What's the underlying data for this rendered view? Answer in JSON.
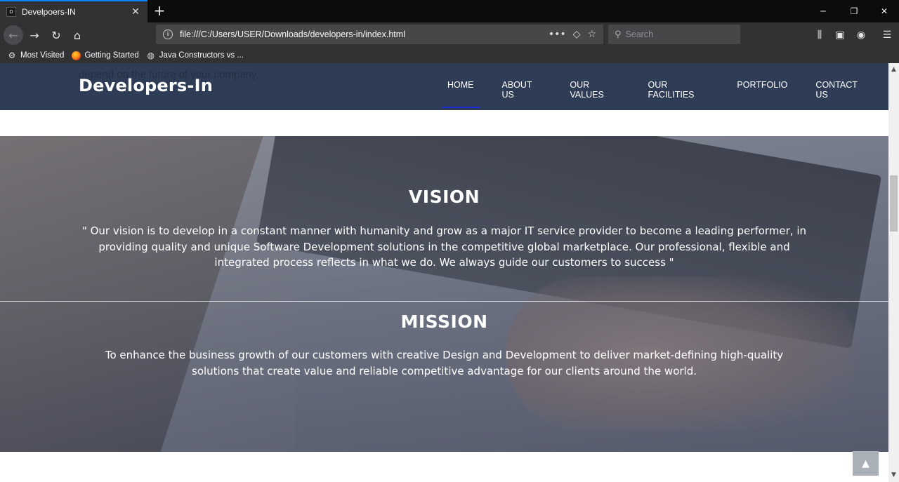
{
  "browser": {
    "tab_title": "Develpoers-IN",
    "favicon_text": "D",
    "url": "file:///C:/Users/USER/Downloads/developers-in/index.html",
    "search_placeholder": "Search",
    "bookmarks": [
      {
        "label": "Most Visited",
        "icon": "gear-icon"
      },
      {
        "label": "Getting Started",
        "icon": "firefox-icon"
      },
      {
        "label": "Java Constructors vs ...",
        "icon": "globe-icon"
      }
    ]
  },
  "site": {
    "behind_text": "depend on the future of your company.",
    "logo": "Developers-In",
    "menu": [
      {
        "label": "HOME",
        "active": true
      },
      {
        "label": "ABOUT US"
      },
      {
        "label": "OUR VALUES"
      },
      {
        "label": "OUR FACILITIES"
      },
      {
        "label": "PORTFOLIO"
      },
      {
        "label": "CONTACT US"
      }
    ],
    "vision": {
      "heading": "VISION",
      "text": "\" Our vision is to develop in a constant manner with humanity and grow as a major IT service provider to become a leading performer, in providing quality and unique Software Development solutions in the competitive global marketplace. Our professional, flexible and integrated process reflects in what we do. We always guide our customers to success \""
    },
    "mission": {
      "heading": "MISSION",
      "text": "To enhance the business growth of our customers with creative Design and Development to deliver market-defining high-quality solutions that create value and reliable competitive advantage for our clients around the world."
    }
  },
  "colors": {
    "header_bg": "#2f3c55",
    "active_underline": "#1a2bd6",
    "chrome_bg": "#323234",
    "tab_accent": "#0a84ff"
  }
}
